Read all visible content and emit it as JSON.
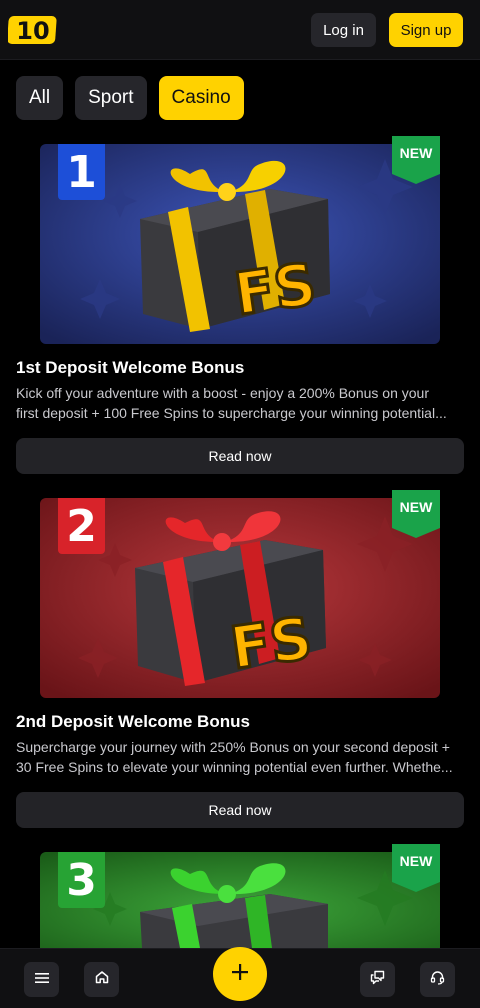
{
  "header": {
    "logo_text": "10",
    "login_label": "Log in",
    "signup_label": "Sign up"
  },
  "filters": [
    {
      "label": "All",
      "active": false
    },
    {
      "label": "Sport",
      "active": false
    },
    {
      "label": "Casino",
      "active": true
    }
  ],
  "promos": [
    {
      "number": "1",
      "badge": "NEW",
      "image_text": "FS",
      "title": "1st Deposit Welcome Bonus",
      "desc_line1": "Kick off your adventure with a boost - enjoy a 200% Bonus on your",
      "desc_line2": "first deposit + 100 Free Spins to supercharge your winning potential...",
      "button": "Read now",
      "bg_color": "#2b3a8a",
      "ribbon_color": "#f2c200",
      "number_color": "#1d4fd8"
    },
    {
      "number": "2",
      "badge": "NEW",
      "image_text": "FS",
      "title": "2nd Deposit Welcome Bonus",
      "desc_line1": "Supercharge your journey with 250% Bonus on your second deposit +",
      "desc_line2": "30 Free Spins to elevate your winning potential even further. Whethe...",
      "button": "Read now",
      "bg_color": "#9c2a2e",
      "ribbon_color": "#e5262a",
      "number_color": "#d8232a"
    },
    {
      "number": "3",
      "badge": "NEW",
      "image_text": "",
      "bg_color": "#2f8a2c",
      "ribbon_color": "#3bd22f",
      "number_color": "#27a334"
    }
  ],
  "icons": {
    "menu": "menu-icon",
    "home": "home-icon",
    "add": "plus-icon",
    "chat": "chat-icon",
    "support": "headset-icon"
  },
  "colors": {
    "accent": "#ffd200",
    "badge_green": "#1aa34a"
  }
}
